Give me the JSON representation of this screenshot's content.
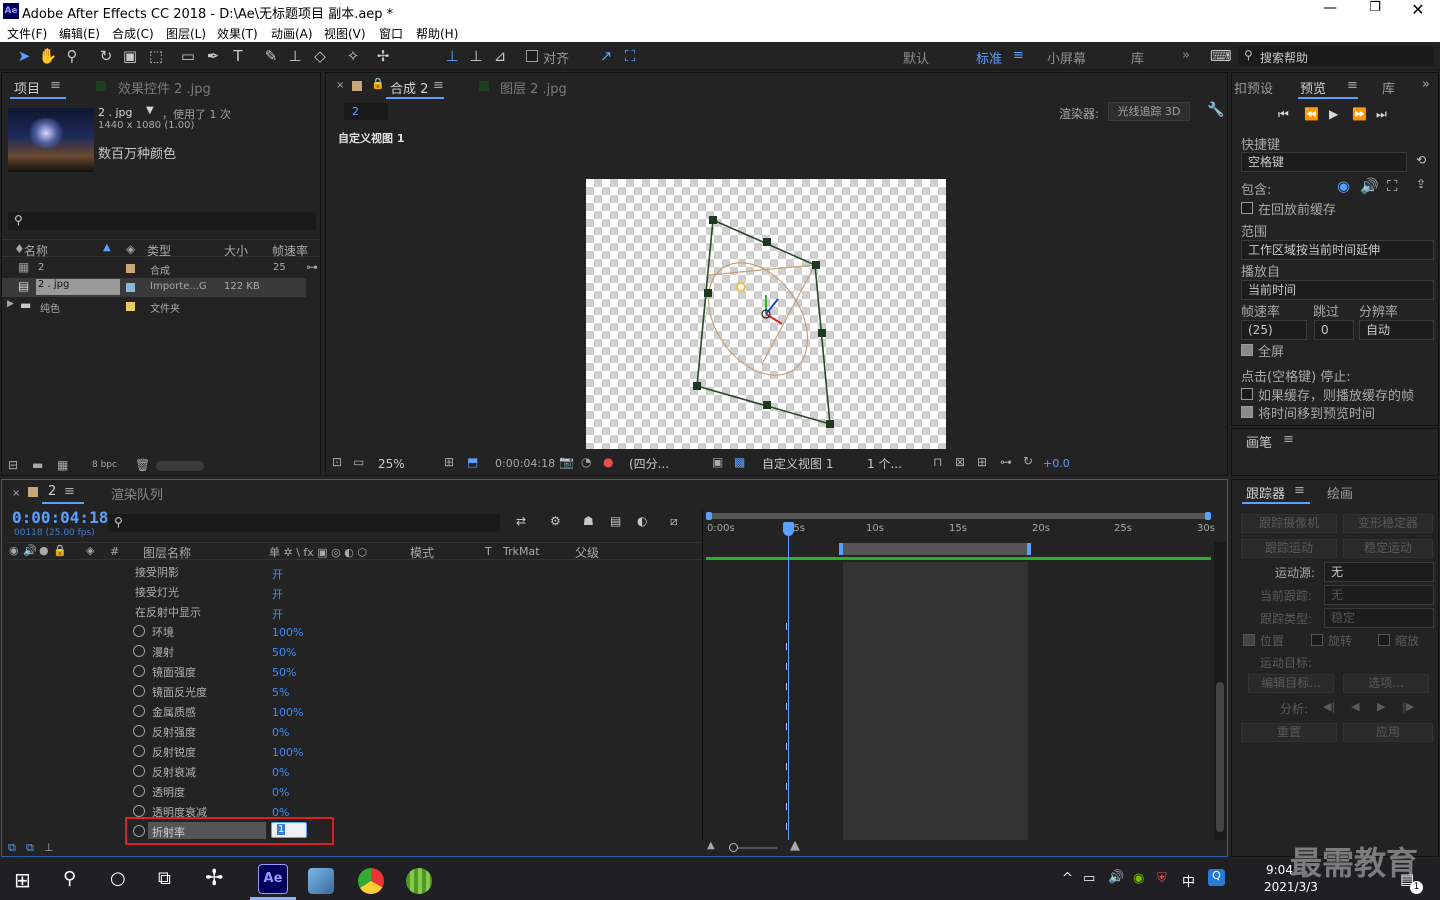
{
  "app": {
    "title": "Adobe After Effects CC 2018 - D:\\Ae\\无标题项目 副本.aep *",
    "logo": "Ae"
  },
  "menu": [
    "文件(F)",
    "编辑(E)",
    "合成(C)",
    "图层(L)",
    "效果(T)",
    "动画(A)",
    "视图(V)",
    "窗口",
    "帮助(H)"
  ],
  "toolbar": {
    "snap_label": "对齐",
    "workspaces": [
      "默认",
      "标准",
      "小屏幕",
      "库"
    ],
    "active_workspace": "标准",
    "search_placeholder": "搜索帮助"
  },
  "project": {
    "tabs": [
      "项目",
      "效果控件 2 .jpg"
    ],
    "asset_name": "2 . jpg",
    "asset_used": "，使用了 1 次",
    "asset_dims": "1440 x 1080 (1.00)",
    "asset_color": "数百万种颜色",
    "search_placeholder": "",
    "columns": [
      "名称",
      "类型",
      "大小",
      "帧速率"
    ],
    "rows": [
      {
        "name": "2",
        "type": "合成",
        "size": "",
        "fps": "25"
      },
      {
        "name": "2 . jpg",
        "type": "Importe...G",
        "size": "122 KB",
        "fps": ""
      },
      {
        "name": "纯色",
        "type": "文件夹",
        "size": "",
        "fps": ""
      }
    ],
    "bpc": "8 bpc"
  },
  "comp": {
    "tabs": [
      "合成 2",
      "图层 2 .jpg"
    ],
    "comp_name": "2",
    "renderer_label": "渲染器:",
    "renderer": "光线追踪 3D",
    "view_label": "自定义视图 1",
    "bottom": {
      "zoom": "25%",
      "time": "0:00:04:18",
      "resolution": "(四分...",
      "view": "自定义视图 1",
      "views": "1 个...",
      "exposure": "+0.0"
    }
  },
  "preview": {
    "tabs": [
      "扣预设",
      "预览",
      "库"
    ],
    "shortcut_label": "快捷键",
    "shortcut": "空格键",
    "include_label": "包含:",
    "cache_before": "在回放前缓存",
    "range_label": "范围",
    "range": "工作区域按当前时间延伸",
    "play_from_label": "播放自",
    "play_from": "当前时间",
    "fps_label": "帧速率",
    "skip_label": "跳过",
    "res_label": "分辨率",
    "fps": "(25)",
    "skip": "0",
    "res": "自动",
    "fullscreen": "全屏",
    "stop_label": "点击(空格键) 停止:",
    "opt1": "如果缓存，则播放缓存的帧",
    "opt2": "将时间移到预览时间",
    "brush_label": "画笔"
  },
  "timeline": {
    "tab": "2",
    "render_queue": "渲染队列",
    "timecode": "0:00:04:18",
    "fps_info": "00118 (25.00 fps)",
    "col_headers": {
      "layer_name": "图层名称",
      "mode": "模式",
      "trkmat": "TrkMat",
      "parent": "父级"
    },
    "properties": [
      {
        "name": "接受阴影",
        "value": "开",
        "stopwatch": false
      },
      {
        "name": "接受灯光",
        "value": "开",
        "stopwatch": false
      },
      {
        "name": "在反射中显示",
        "value": "开",
        "stopwatch": false
      },
      {
        "name": "环境",
        "value": "100%",
        "stopwatch": true
      },
      {
        "name": "漫射",
        "value": "50%",
        "stopwatch": true
      },
      {
        "name": "镜面强度",
        "value": "50%",
        "stopwatch": true
      },
      {
        "name": "镜面反光度",
        "value": "5%",
        "stopwatch": true
      },
      {
        "name": "金属质感",
        "value": "100%",
        "stopwatch": true
      },
      {
        "name": "反射强度",
        "value": "0%",
        "stopwatch": true
      },
      {
        "name": "反射锐度",
        "value": "100%",
        "stopwatch": true
      },
      {
        "name": "反射衰减",
        "value": "0%",
        "stopwatch": true
      },
      {
        "name": "透明度",
        "value": "0%",
        "stopwatch": true
      },
      {
        "name": "透明度衰减",
        "value": "0%",
        "stopwatch": true
      },
      {
        "name": "折射率",
        "value": "1",
        "stopwatch": true
      }
    ],
    "ruler": [
      "0:00s",
      "05s",
      "10s",
      "15s",
      "20s",
      "25s",
      "30s"
    ]
  },
  "tracker": {
    "tabs": [
      "跟踪器",
      "绘画"
    ],
    "track_camera": "跟踪摄像机",
    "warp_stabilize": "变形稳定器",
    "track_motion": "跟踪运动",
    "stabilize_motion": "稳定运动",
    "source_label": "运动源:",
    "source": "无",
    "current_track_label": "当前跟踪:",
    "current_track": "无",
    "track_type_label": "跟踪类型:",
    "track_type": "稳定",
    "position": "位置",
    "rotation": "旋转",
    "scale": "缩放",
    "motion_target": "运动目标:",
    "edit_target": "编辑目标...",
    "options": "选项...",
    "analyze": "分析:",
    "reset": "重置",
    "apply": "应用"
  },
  "taskbar": {
    "time": "9:04",
    "date": "2021/3/3",
    "ime": "中",
    "badge": "1"
  },
  "watermark": "最需教育"
}
